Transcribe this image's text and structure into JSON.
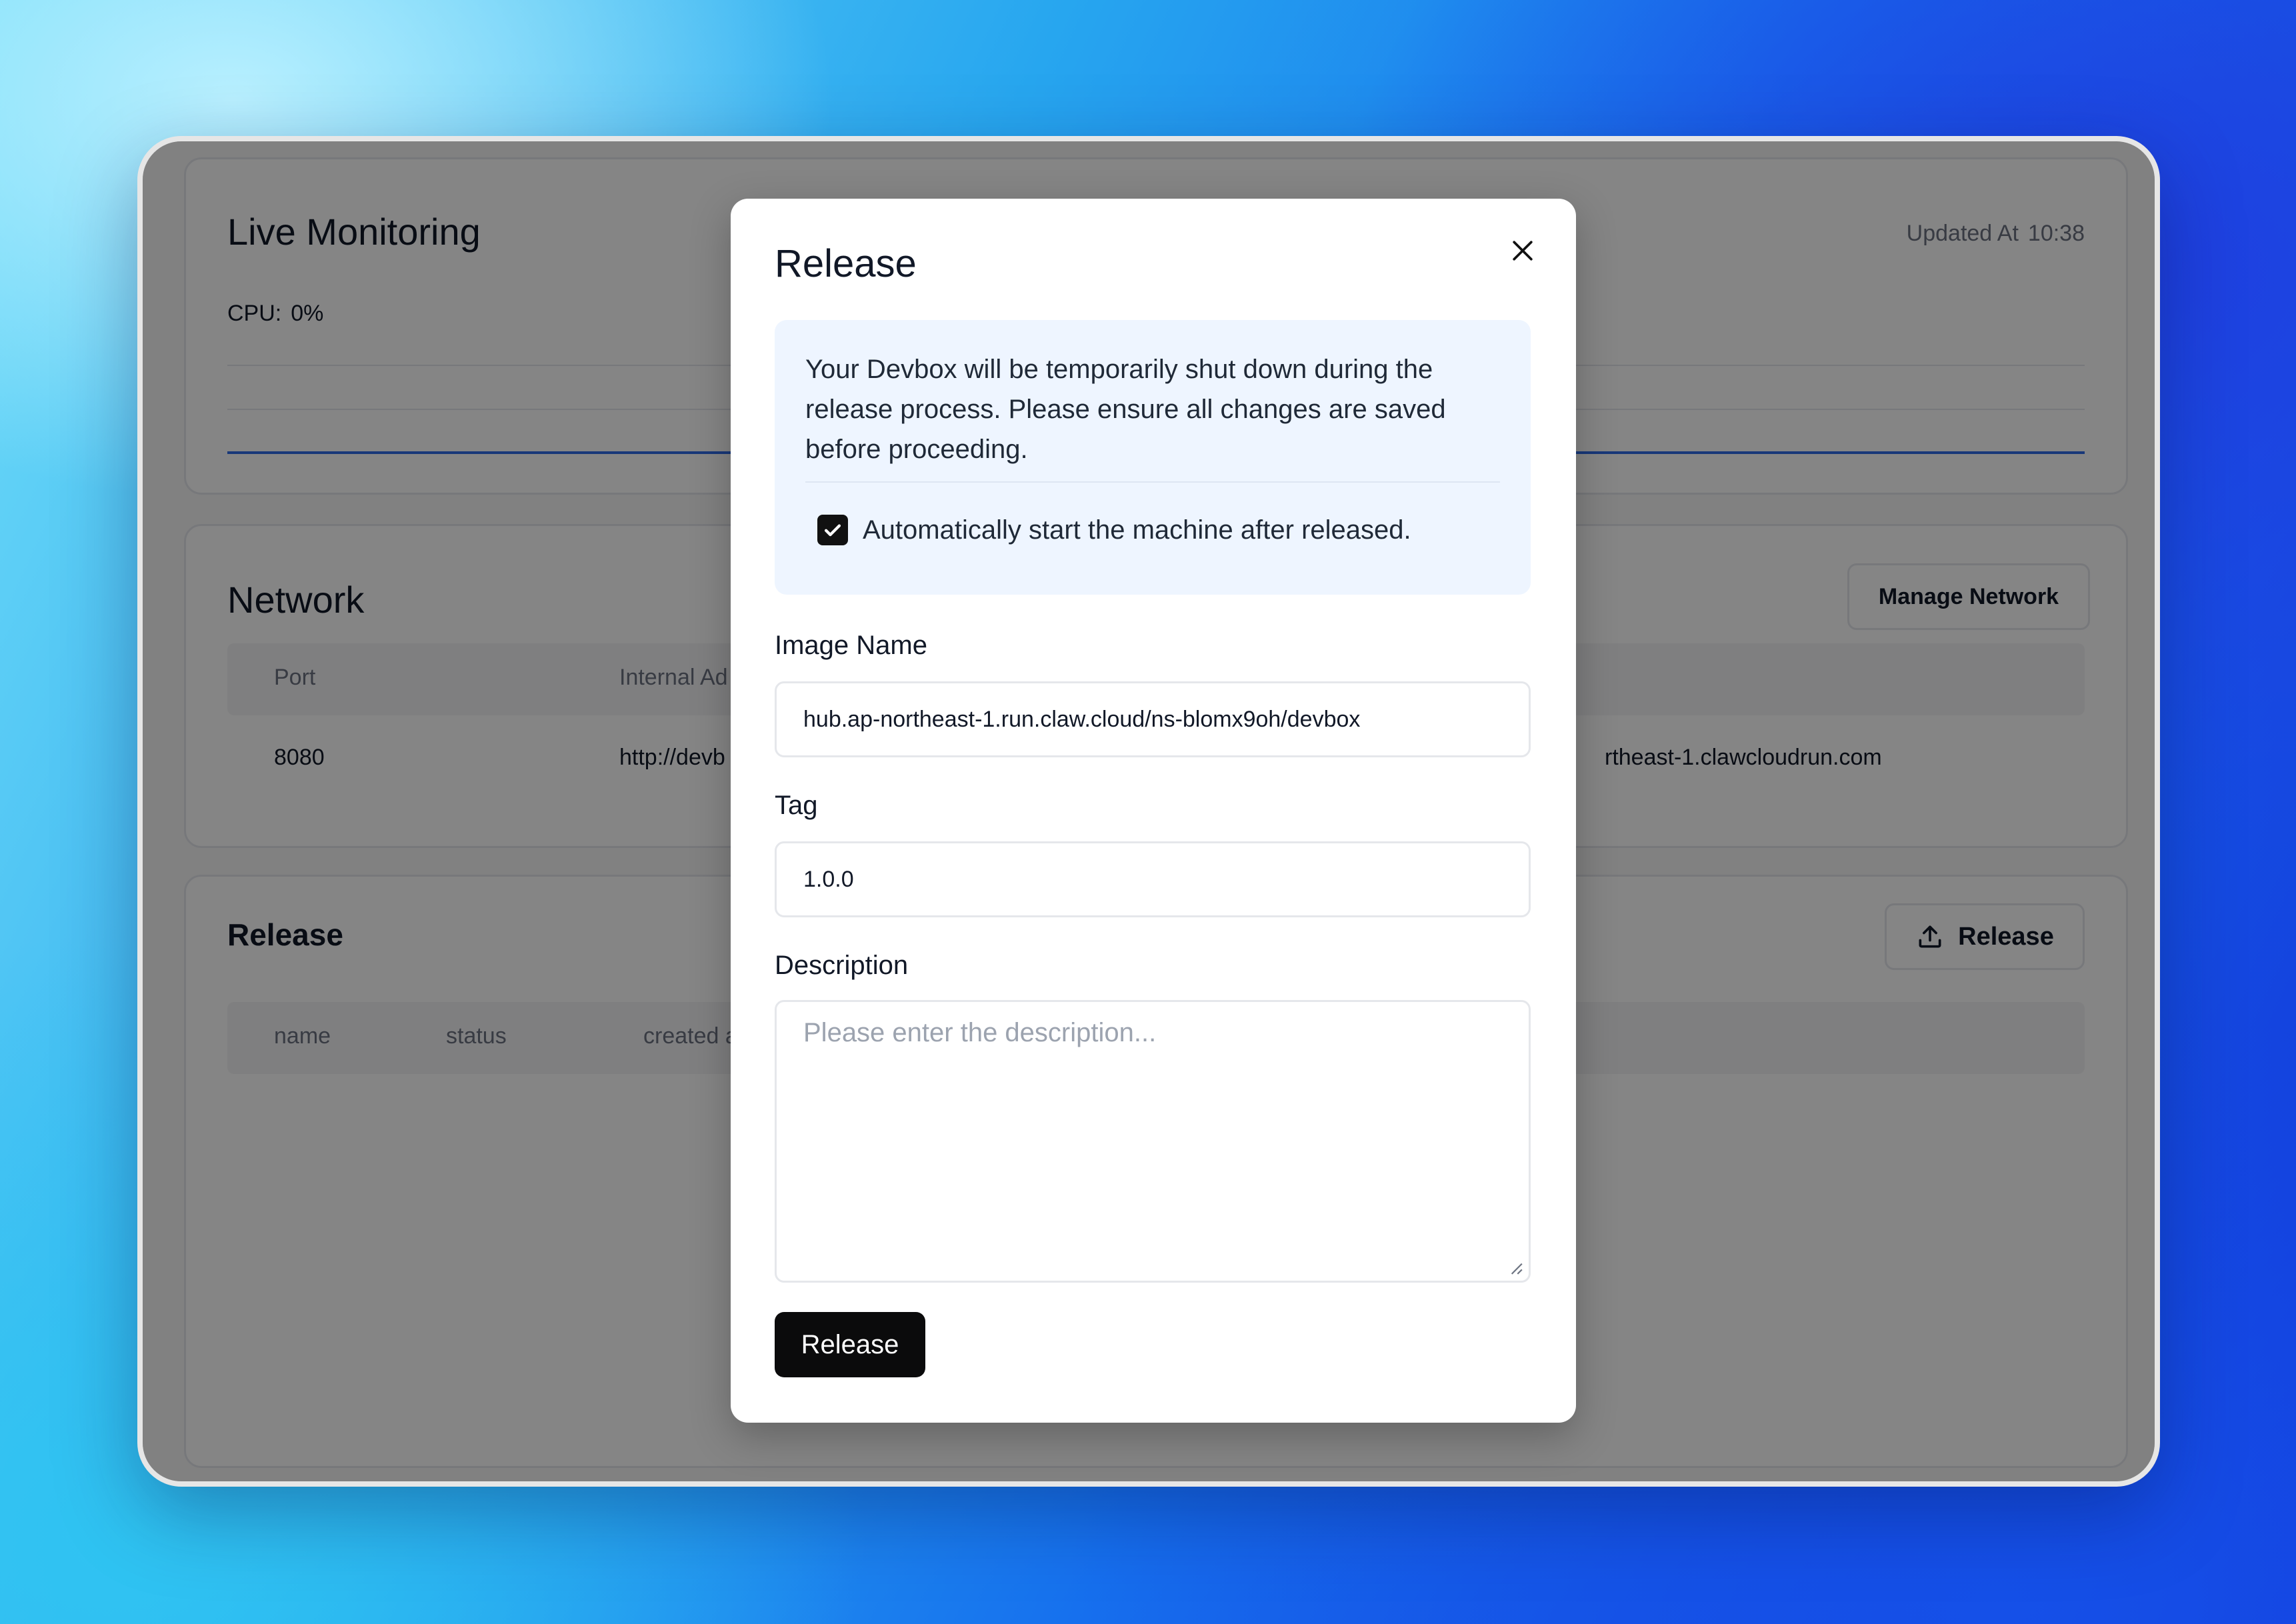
{
  "monitoring": {
    "title": "Live Monitoring",
    "updated_label": "Updated At",
    "updated_time": "10:38",
    "cpu_label": "CPU:",
    "cpu_value": "0%"
  },
  "network": {
    "title": "Network",
    "manage_label": "Manage Network",
    "columns": [
      "Port",
      "Internal Ad"
    ],
    "rows": [
      {
        "port": "8080",
        "internal": "http://devb",
        "external": "rtheast-1.clawcloudrun.com"
      }
    ]
  },
  "release_section": {
    "title": "Release",
    "button_label": "Release",
    "columns": [
      "name",
      "status",
      "created a"
    ]
  },
  "modal": {
    "title": "Release",
    "notice": "Your Devbox will be temporarily shut down during the release process. Please ensure all changes are saved before proceeding.",
    "auto_start_label": "Automatically start the machine after released.",
    "auto_start_checked": true,
    "image_name_label": "Image Name",
    "image_name_value": "hub.ap-northeast-1.run.claw.cloud/ns-blomx9oh/devbox",
    "tag_label": "Tag",
    "tag_value": "1.0.0",
    "description_label": "Description",
    "description_placeholder": "Please enter the  description...",
    "submit_label": "Release"
  },
  "colors": {
    "accent_line": "#2f6be8",
    "primary_button": "#0b0b0c",
    "notice_bg": "#eef5ff"
  },
  "icons": {
    "close": "close-icon",
    "upload": "upload-icon",
    "check": "check-icon"
  }
}
